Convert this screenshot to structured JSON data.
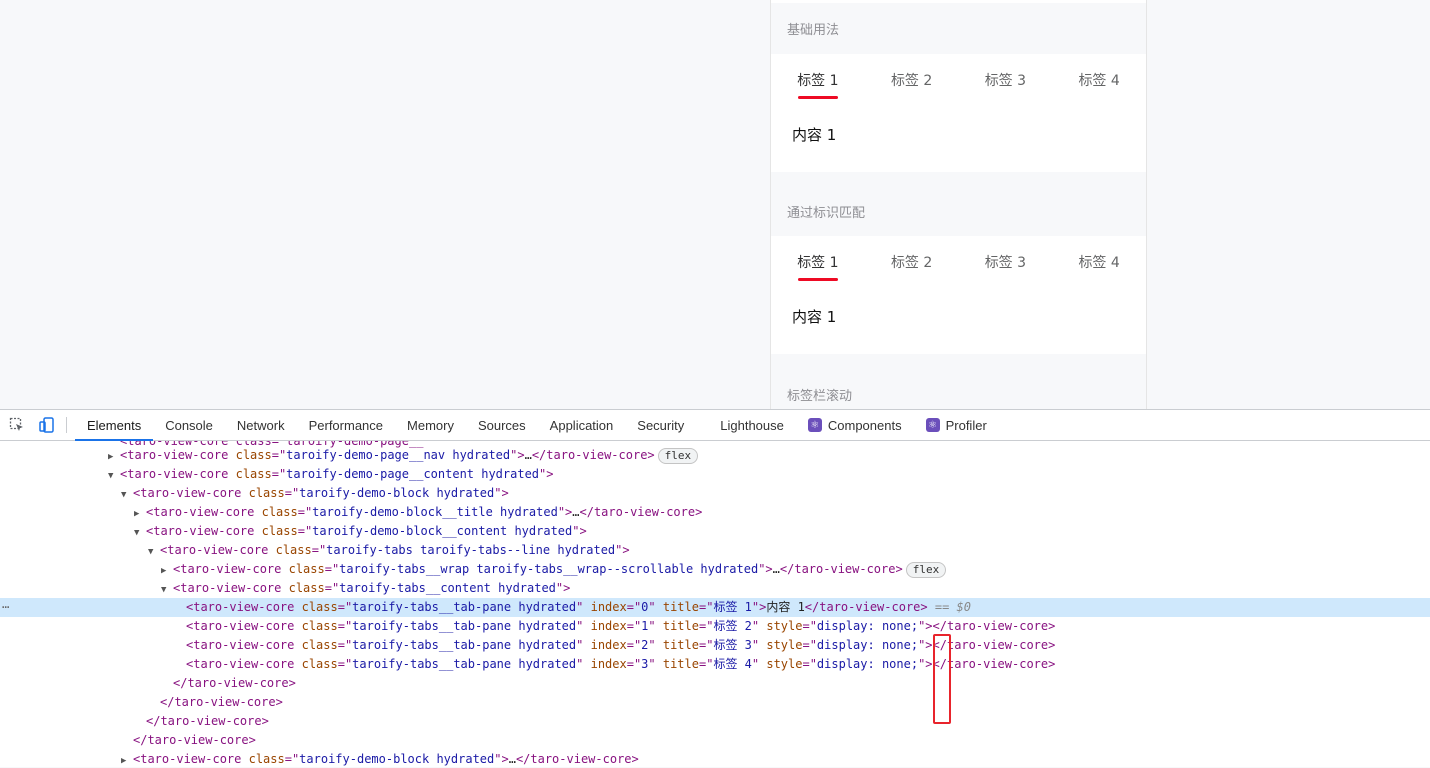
{
  "demo": {
    "blocks": [
      {
        "title": "基础用法",
        "tabs": [
          "标签 1",
          "标签 2",
          "标签 3",
          "标签 4"
        ],
        "active_tab": 0,
        "content": "内容 1"
      },
      {
        "title": "通过标识匹配",
        "tabs": [
          "标签 1",
          "标签 2",
          "标签 3",
          "标签 4"
        ],
        "active_tab": 0,
        "content": "内容 1"
      },
      {
        "title": "标签栏滚动"
      }
    ],
    "accent_color": "#ee0a24"
  },
  "devtools": {
    "toolbar": {
      "inspect_icon": "inspect-element-icon",
      "device_icon": "device-toolbar-icon",
      "tabs": [
        "Elements",
        "Console",
        "Network",
        "Performance",
        "Memory",
        "Sources",
        "Application",
        "Security",
        "Lighthouse",
        "Components",
        "Profiler"
      ],
      "active_tab": "Elements"
    },
    "dom_lines": [
      {
        "indent": 9,
        "arrow": "▶",
        "parts": [
          [
            "tag",
            "<taro-view-core "
          ],
          [
            "an",
            "class"
          ],
          [
            "tag",
            "=\""
          ],
          [
            "av",
            "taroify-demo-page__nav hydrated"
          ],
          [
            "tag",
            "\">"
          ],
          [
            "txt",
            "…"
          ],
          [
            "tag",
            "</taro-view-core>"
          ]
        ],
        "pill": "flex"
      },
      {
        "indent": 9,
        "arrow": "▼",
        "parts": [
          [
            "tag",
            "<taro-view-core "
          ],
          [
            "an",
            "class"
          ],
          [
            "tag",
            "=\""
          ],
          [
            "av",
            "taroify-demo-page__content hydrated"
          ],
          [
            "tag",
            "\">"
          ]
        ]
      },
      {
        "indent": 10,
        "arrow": "▼",
        "parts": [
          [
            "tag",
            "<taro-view-core "
          ],
          [
            "an",
            "class"
          ],
          [
            "tag",
            "=\""
          ],
          [
            "av",
            "taroify-demo-block hydrated"
          ],
          [
            "tag",
            "\">"
          ]
        ]
      },
      {
        "indent": 11,
        "arrow": "▶",
        "parts": [
          [
            "tag",
            "<taro-view-core "
          ],
          [
            "an",
            "class"
          ],
          [
            "tag",
            "=\""
          ],
          [
            "av",
            "taroify-demo-block__title hydrated"
          ],
          [
            "tag",
            "\">"
          ],
          [
            "txt",
            "…"
          ],
          [
            "tag",
            "</taro-view-core>"
          ]
        ]
      },
      {
        "indent": 11,
        "arrow": "▼",
        "parts": [
          [
            "tag",
            "<taro-view-core "
          ],
          [
            "an",
            "class"
          ],
          [
            "tag",
            "=\""
          ],
          [
            "av",
            "taroify-demo-block__content hydrated"
          ],
          [
            "tag",
            "\">"
          ]
        ]
      },
      {
        "indent": 12,
        "arrow": "▼",
        "parts": [
          [
            "tag",
            "<taro-view-core "
          ],
          [
            "an",
            "class"
          ],
          [
            "tag",
            "=\""
          ],
          [
            "av",
            "taroify-tabs taroify-tabs--line hydrated"
          ],
          [
            "tag",
            "\">"
          ]
        ]
      },
      {
        "indent": 13,
        "arrow": "▶",
        "parts": [
          [
            "tag",
            "<taro-view-core "
          ],
          [
            "an",
            "class"
          ],
          [
            "tag",
            "=\""
          ],
          [
            "av",
            "taroify-tabs__wrap taroify-tabs__wrap--scrollable hydrated"
          ],
          [
            "tag",
            "\">"
          ],
          [
            "txt",
            "…"
          ],
          [
            "tag",
            "</taro-view-core>"
          ]
        ],
        "pill": "flex"
      },
      {
        "indent": 13,
        "arrow": "▼",
        "parts": [
          [
            "tag",
            "<taro-view-core "
          ],
          [
            "an",
            "class"
          ],
          [
            "tag",
            "=\""
          ],
          [
            "av",
            "taroify-tabs__content hydrated"
          ],
          [
            "tag",
            "\">"
          ]
        ]
      },
      {
        "indent": 14,
        "arrow": "",
        "selected": true,
        "parts": [
          [
            "tag",
            "<taro-view-core "
          ],
          [
            "an",
            "class"
          ],
          [
            "tag",
            "=\""
          ],
          [
            "av",
            "taroify-tabs__tab-pane hydrated"
          ],
          [
            "tag",
            "\" "
          ],
          [
            "an",
            "index"
          ],
          [
            "tag",
            "=\""
          ],
          [
            "av",
            "0"
          ],
          [
            "tag",
            "\" "
          ],
          [
            "an",
            "title"
          ],
          [
            "tag",
            "=\""
          ],
          [
            "av",
            "标签 1"
          ],
          [
            "tag",
            "\">"
          ],
          [
            "txt",
            "内容 1"
          ],
          [
            "tag",
            "</taro-view-core>"
          ]
        ],
        "suffix": " == $0"
      },
      {
        "indent": 14,
        "arrow": "",
        "parts": [
          [
            "tag",
            "<taro-view-core "
          ],
          [
            "an",
            "class"
          ],
          [
            "tag",
            "=\""
          ],
          [
            "av",
            "taroify-tabs__tab-pane hydrated"
          ],
          [
            "tag",
            "\" "
          ],
          [
            "an",
            "index"
          ],
          [
            "tag",
            "=\""
          ],
          [
            "av",
            "1"
          ],
          [
            "tag",
            "\" "
          ],
          [
            "an",
            "title"
          ],
          [
            "tag",
            "=\""
          ],
          [
            "av",
            "标签 2"
          ],
          [
            "tag",
            "\" "
          ],
          [
            "an",
            "style"
          ],
          [
            "tag",
            "=\""
          ],
          [
            "av",
            "display: none;"
          ],
          [
            "tag",
            "\">"
          ],
          [
            "tag",
            "</taro-view-core>"
          ]
        ]
      },
      {
        "indent": 14,
        "arrow": "",
        "parts": [
          [
            "tag",
            "<taro-view-core "
          ],
          [
            "an",
            "class"
          ],
          [
            "tag",
            "=\""
          ],
          [
            "av",
            "taroify-tabs__tab-pane hydrated"
          ],
          [
            "tag",
            "\" "
          ],
          [
            "an",
            "index"
          ],
          [
            "tag",
            "=\""
          ],
          [
            "av",
            "2"
          ],
          [
            "tag",
            "\" "
          ],
          [
            "an",
            "title"
          ],
          [
            "tag",
            "=\""
          ],
          [
            "av",
            "标签 3"
          ],
          [
            "tag",
            "\" "
          ],
          [
            "an",
            "style"
          ],
          [
            "tag",
            "=\""
          ],
          [
            "av",
            "display: none;"
          ],
          [
            "tag",
            "\">"
          ],
          [
            "tag",
            "</taro-view-core>"
          ]
        ]
      },
      {
        "indent": 14,
        "arrow": "",
        "parts": [
          [
            "tag",
            "<taro-view-core "
          ],
          [
            "an",
            "class"
          ],
          [
            "tag",
            "=\""
          ],
          [
            "av",
            "taroify-tabs__tab-pane hydrated"
          ],
          [
            "tag",
            "\" "
          ],
          [
            "an",
            "index"
          ],
          [
            "tag",
            "=\""
          ],
          [
            "av",
            "3"
          ],
          [
            "tag",
            "\" "
          ],
          [
            "an",
            "title"
          ],
          [
            "tag",
            "=\""
          ],
          [
            "av",
            "标签 4"
          ],
          [
            "tag",
            "\" "
          ],
          [
            "an",
            "style"
          ],
          [
            "tag",
            "=\""
          ],
          [
            "av",
            "display: none;"
          ],
          [
            "tag",
            "\">"
          ],
          [
            "tag",
            "</taro-view-core>"
          ]
        ]
      },
      {
        "indent": 13,
        "arrow": "",
        "parts": [
          [
            "tag",
            "</taro-view-core>"
          ]
        ]
      },
      {
        "indent": 12,
        "arrow": "",
        "parts": [
          [
            "tag",
            "</taro-view-core>"
          ]
        ]
      },
      {
        "indent": 11,
        "arrow": "",
        "parts": [
          [
            "tag",
            "</taro-view-core>"
          ]
        ]
      },
      {
        "indent": 10,
        "arrow": "",
        "parts": [
          [
            "tag",
            "</taro-view-core>"
          ]
        ]
      },
      {
        "indent": 10,
        "arrow": "▶",
        "parts": [
          [
            "tag",
            "<taro-view-core "
          ],
          [
            "an",
            "class"
          ],
          [
            "tag",
            "=\""
          ],
          [
            "av",
            "taroify-demo-block hydrated"
          ],
          [
            "tag",
            "\">"
          ],
          [
            "txt",
            "…"
          ],
          [
            "tag",
            "</taro-view-core>"
          ]
        ]
      }
    ],
    "highlight_color": "#e8242c"
  }
}
